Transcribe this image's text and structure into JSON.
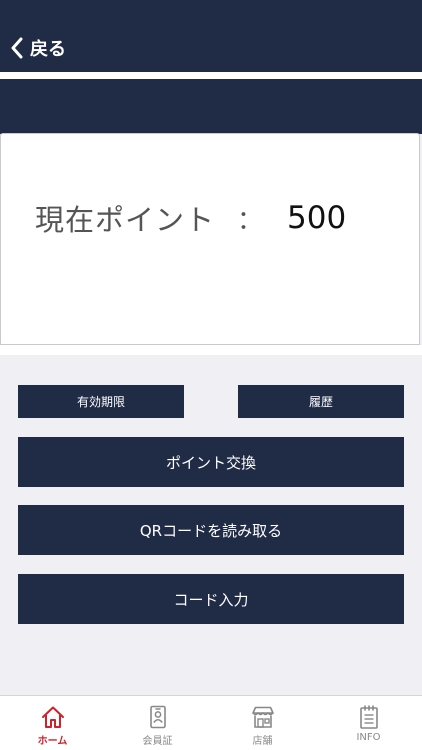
{
  "header": {
    "back_label": "戻る"
  },
  "points": {
    "label": "現在ポイント",
    "separator": "：",
    "value": "500"
  },
  "actions": {
    "expiry_label": "有効期限",
    "history_label": "履歴",
    "exchange_label": "ポイント交換",
    "qr_label": "QRコードを読み取る",
    "code_input_label": "コード入力"
  },
  "tabs": [
    {
      "label": "ホーム",
      "icon": "home-icon",
      "active": true
    },
    {
      "label": "会員証",
      "icon": "member-card-icon",
      "active": false
    },
    {
      "label": "店舗",
      "icon": "store-icon",
      "active": false
    },
    {
      "label": "INFO",
      "icon": "notepad-icon",
      "active": false
    }
  ],
  "colors": {
    "navy": "#202b46",
    "active_tab": "#d0202a",
    "inactive_tab": "#888888",
    "background": "#f0eff4"
  }
}
